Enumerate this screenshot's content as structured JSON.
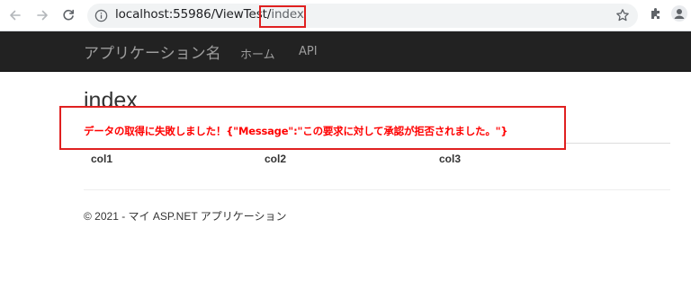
{
  "browser": {
    "url_host": "localhost:55986/ViewTest/",
    "url_path": "index",
    "icons": {
      "back": "arrow-left-icon",
      "forward": "arrow-right-icon",
      "reload": "reload-icon",
      "info": "info-icon",
      "bookmark": "star-icon",
      "extensions": "puzzle-icon",
      "profile": "person-icon"
    }
  },
  "navbar": {
    "brand": "アプリケーション名",
    "links": [
      {
        "label": "ホーム"
      },
      {
        "label": "API"
      }
    ]
  },
  "main": {
    "title": "index",
    "error_message": "データの取得に失敗しました！{\"Message\":\"この要求に対して承認が拒否されました。\"}",
    "table": {
      "columns": [
        "col1",
        "col2",
        "col3"
      ]
    }
  },
  "footer": {
    "text": "© 2021 - マイ ASP.NET アプリケーション"
  },
  "colors": {
    "navbar_bg": "#222222",
    "navbar_text": "#9d9d9d",
    "error_text": "#ff0000",
    "annotation": "#e02020"
  }
}
